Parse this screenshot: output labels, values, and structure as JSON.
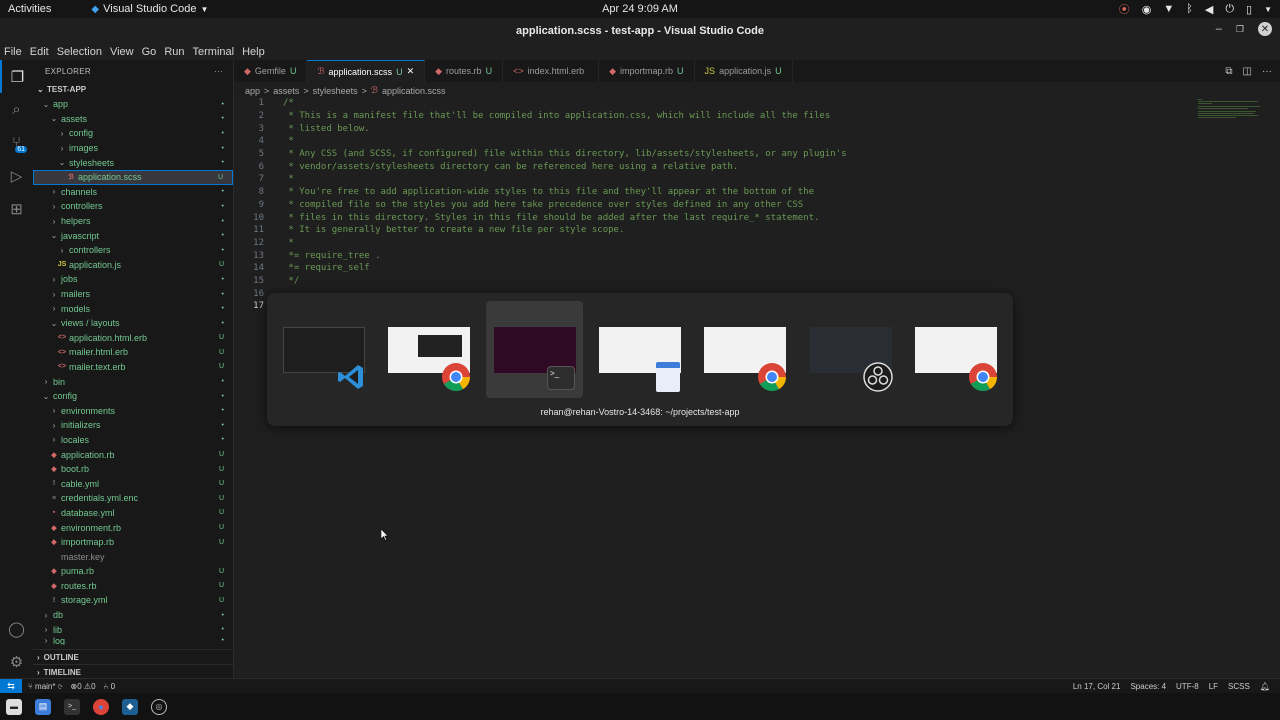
{
  "topbar": {
    "activities": "Activities",
    "app_name": "Visual Studio Code",
    "clock": "Apr 24  9:09 AM"
  },
  "window": {
    "title": "application.scss - test-app - Visual Studio Code"
  },
  "menu": [
    "File",
    "Edit",
    "Selection",
    "View",
    "Go",
    "Run",
    "Terminal",
    "Help"
  ],
  "sidebar": {
    "title": "EXPLORER",
    "more": "···",
    "root": "TEST-APP",
    "tree": [
      {
        "label": "app",
        "status": "•"
      },
      {
        "label": "assets",
        "status": "•"
      },
      {
        "label": "config",
        "status": "•"
      },
      {
        "label": "images",
        "status": "•"
      },
      {
        "label": "stylesheets",
        "status": "•"
      },
      {
        "label": "application.scss",
        "status": "U"
      },
      {
        "label": "channels",
        "status": "•"
      },
      {
        "label": "controllers",
        "status": "•"
      },
      {
        "label": "helpers",
        "status": "•"
      },
      {
        "label": "javascript",
        "status": "•"
      },
      {
        "label": "controllers",
        "status": "•"
      },
      {
        "label": "application.js",
        "status": "U"
      },
      {
        "label": "jobs",
        "status": "•"
      },
      {
        "label": "mailers",
        "status": "•"
      },
      {
        "label": "models",
        "status": "•"
      },
      {
        "label": "views / layouts",
        "status": "•"
      },
      {
        "label": "application.html.erb",
        "status": "U"
      },
      {
        "label": "mailer.html.erb",
        "status": "U"
      },
      {
        "label": "mailer.text.erb",
        "status": "U"
      },
      {
        "label": "bin",
        "status": "•"
      },
      {
        "label": "config",
        "status": "•"
      },
      {
        "label": "environments",
        "status": "•"
      },
      {
        "label": "initializers",
        "status": "•"
      },
      {
        "label": "locales",
        "status": "•"
      },
      {
        "label": "application.rb",
        "status": "U"
      },
      {
        "label": "boot.rb",
        "status": "U"
      },
      {
        "label": "cable.yml",
        "status": "U"
      },
      {
        "label": "credentials.yml.enc",
        "status": "U"
      },
      {
        "label": "database.yml",
        "status": "U"
      },
      {
        "label": "environment.rb",
        "status": "U"
      },
      {
        "label": "importmap.rb",
        "status": "U"
      },
      {
        "label": "master.key",
        "status": ""
      },
      {
        "label": "puma.rb",
        "status": "U"
      },
      {
        "label": "routes.rb",
        "status": "U"
      },
      {
        "label": "storage.yml",
        "status": "U"
      },
      {
        "label": "db",
        "status": "•"
      },
      {
        "label": "lib",
        "status": "•"
      },
      {
        "label": "log",
        "status": "•"
      }
    ],
    "outline": "OUTLINE",
    "timeline": "TIMELINE"
  },
  "tabs": [
    {
      "label": "Gemfile",
      "status": "U"
    },
    {
      "label": "application.scss",
      "status": "U",
      "close": "✕"
    },
    {
      "label": "routes.rb",
      "status": "U"
    },
    {
      "label": "index.html.erb",
      "status": ""
    },
    {
      "label": "importmap.rb",
      "status": "U"
    },
    {
      "label": "application.js",
      "status": "U"
    }
  ],
  "breadcrumb": [
    "app",
    ">",
    "assets",
    ">",
    "stylesheets",
    ">",
    "application.scss"
  ],
  "code": [
    {
      "n": "1",
      "t": "/*"
    },
    {
      "n": "2",
      "t": " * This is a manifest file that'll be compiled into application.css, which will include all the files"
    },
    {
      "n": "3",
      "t": " * listed below."
    },
    {
      "n": "4",
      "t": " *"
    },
    {
      "n": "5",
      "t": " * Any CSS (and SCSS, if configured) file within this directory, lib/assets/stylesheets, or any plugin's"
    },
    {
      "n": "6",
      "t": " * vendor/assets/stylesheets directory can be referenced here using a relative path."
    },
    {
      "n": "7",
      "t": " *"
    },
    {
      "n": "8",
      "t": " * You're free to add application-wide styles to this file and they'll appear at the bottom of the"
    },
    {
      "n": "9",
      "t": " * compiled file so the styles you add here take precedence over styles defined in any other CSS"
    },
    {
      "n": "10",
      "t": " * files in this directory. Styles in this file should be added after the last require_* statement."
    },
    {
      "n": "11",
      "t": " * It is generally better to create a new file per style scope."
    },
    {
      "n": "12",
      "t": " *"
    },
    {
      "n": "13",
      "t": " *= require_tree ."
    },
    {
      "n": "14",
      "t": " *= require_self"
    },
    {
      "n": "15",
      "t": " */"
    },
    {
      "n": "16",
      "t": ""
    },
    {
      "n": "17",
      "t": ""
    }
  ],
  "switcher": {
    "caption": "rehan@rehan-Vostro-14-3468: ~/projects/test-app"
  },
  "status": {
    "branch": "main*",
    "errors": "0",
    "warnings": "0",
    "ports": "0",
    "position": "Ln 17, Col 21",
    "spaces": "Spaces: 4",
    "encoding": "UTF-8",
    "eol": "LF",
    "language": "SCSS"
  }
}
